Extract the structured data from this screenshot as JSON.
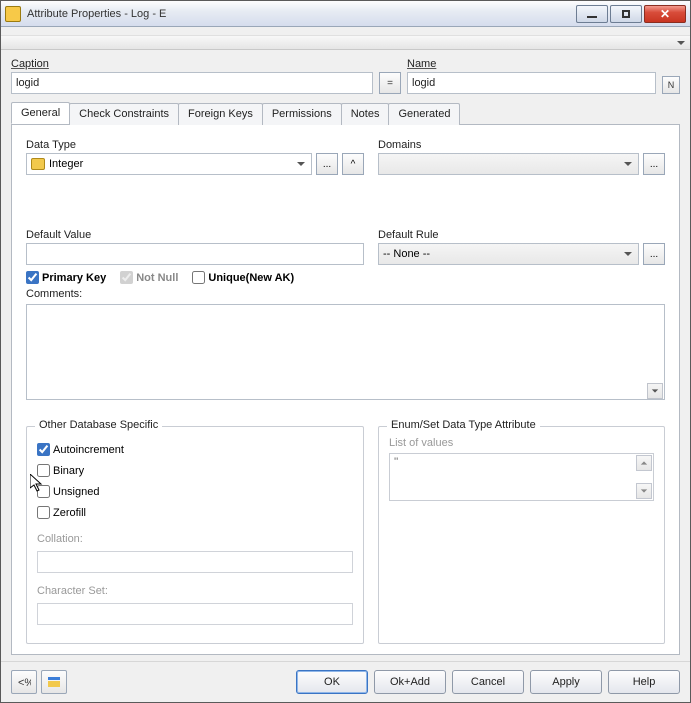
{
  "window": {
    "title": "Attribute Properties - Log - E"
  },
  "caption": {
    "label": "Caption",
    "value": "logid"
  },
  "name": {
    "label": "Name",
    "value": "logid"
  },
  "eq_button": "=",
  "tabs": {
    "general": "General",
    "check_constraints": "Check Constraints",
    "foreign_keys": "Foreign Keys",
    "permissions": "Permissions",
    "notes": "Notes",
    "generated": "Generated"
  },
  "datatype": {
    "label": "Data Type",
    "value": "Integer"
  },
  "domains": {
    "label": "Domains",
    "value": ""
  },
  "ellipsis": "...",
  "caret_up": "^",
  "default_value": {
    "label": "Default Value",
    "value": ""
  },
  "default_rule": {
    "label": "Default Rule",
    "value": "-- None --"
  },
  "checks": {
    "primary_key": "Primary Key",
    "not_null": "Not Null",
    "unique": "Unique(New AK)"
  },
  "comments": {
    "label": "Comments:",
    "value": ""
  },
  "other_db": {
    "legend": "Other Database Specific",
    "autoincrement": "Autoincrement",
    "binary": "Binary",
    "unsigned": "Unsigned",
    "zerofill": "Zerofill",
    "collation": "Collation:",
    "character_set": "Character Set:"
  },
  "enum": {
    "legend": "Enum/Set Data Type Attribute",
    "list_label": "List of values",
    "placeholder": "''"
  },
  "buttons": {
    "ok": "OK",
    "ok_add": "Ok+Add",
    "cancel": "Cancel",
    "apply": "Apply",
    "help": "Help"
  }
}
